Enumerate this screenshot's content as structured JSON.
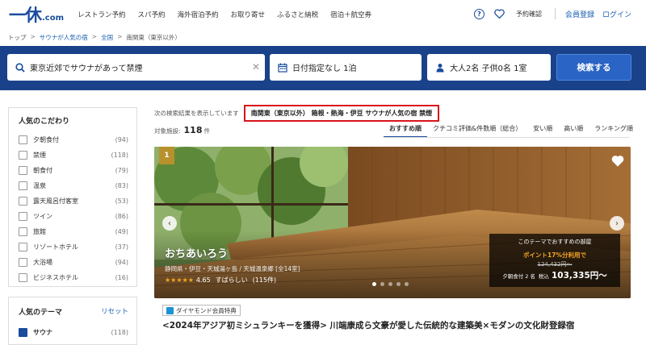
{
  "header": {
    "logo_mark": "一休",
    "logo_suffix": ".com",
    "nav": [
      "レストラン予約",
      "スパ予約",
      "海外宿泊予約",
      "お取り寄せ",
      "ふるさと納税",
      "宿泊＋航空券"
    ],
    "help_label": "?",
    "booking_check": "予約確認",
    "register": "会員登録",
    "login": "ログイン"
  },
  "breadcrumb": [
    "トップ",
    "サウナが人気の宿",
    "全国",
    "南関東（東京以外）"
  ],
  "search": {
    "keyword": "東京近郊でサウナがあって禁煙",
    "date": "日付指定なし 1泊",
    "guests": "大人2名 子供0名 1室",
    "button": "検索する"
  },
  "sidebar": {
    "title": "人気のこだわり",
    "items": [
      {
        "label": "夕朝食付",
        "count": "(94)"
      },
      {
        "label": "禁煙",
        "count": "(118)"
      },
      {
        "label": "朝食付",
        "count": "(79)"
      },
      {
        "label": "温泉",
        "count": "(83)"
      },
      {
        "label": "露天風呂付客室",
        "count": "(53)"
      },
      {
        "label": "ツイン",
        "count": "(86)"
      },
      {
        "label": "旅館",
        "count": "(49)"
      },
      {
        "label": "リゾートホテル",
        "count": "(37)"
      },
      {
        "label": "大浴場",
        "count": "(94)"
      },
      {
        "label": "ビジネスホテル",
        "count": "(16)"
      }
    ],
    "theme_title": "人気のテーマ",
    "theme_reset": "リセット",
    "theme_items": [
      {
        "label": "サウナ",
        "count": "(118)"
      }
    ]
  },
  "results": {
    "lead": "次の検索結果を表示しています",
    "condition": "南関東（東京以外） 箱根・熱海・伊豆 サウナが人気の宿 禁煙",
    "count_label": "対象施設:",
    "count": "118",
    "count_unit": "件",
    "sorts": [
      "おすすめ順",
      "クチコミ評価&件数順（総合）",
      "安い順",
      "高い順",
      "ランキング順"
    ],
    "active_sort": 0
  },
  "hotel": {
    "rank": "1",
    "name": "おちあいろう",
    "location": "静岡県・伊豆・天城湯ヶ島 / 天城温泉郷 [全14室]",
    "stars": "★★★★★",
    "score": "4.65",
    "score_word": "すばらしい",
    "reviews": "(115件)",
    "plan_title": "このテーマでおすすめの部屋",
    "plan_point": "ポイント17%分利用で",
    "plan_old_price": "124,432円〜",
    "plan_meal": "夕朝食付 2 名",
    "plan_tax": "税込",
    "plan_price": "103,335円〜",
    "badge": "ダイヤモンド会員特典",
    "catch": "<2024年アジア初ミシュランキーを獲得> 川端康成ら文豪が愛した伝統的な建築美×モダンの文化財登録宿"
  },
  "colors": {
    "brand": "#1a4c9c",
    "search_bg": "#19428a",
    "search_button": "#2a64c5",
    "highlight_border": "#d8141c",
    "rank_badge": "#b7912c",
    "star": "#f5a623"
  }
}
